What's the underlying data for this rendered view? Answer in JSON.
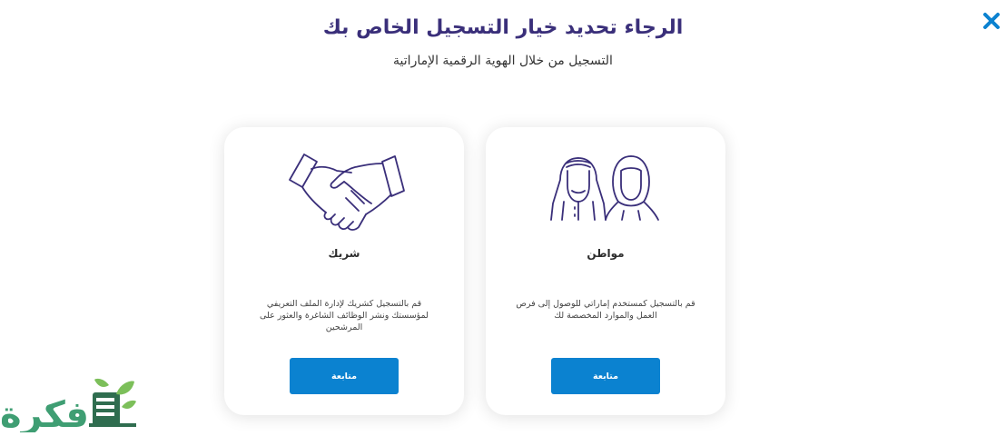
{
  "dialog": {
    "title": "الرجاء تحديد خيار التسجيل الخاص بك",
    "subtitle": "التسجيل من خلال الهوية الرقمية الإماراتية",
    "close_icon": "close-icon",
    "accent_color": "#0b82d0",
    "title_color": "#3a2f7a"
  },
  "cards": {
    "citizen": {
      "title": "مواطن",
      "description": "قم بالتسجيل كمستخدم إماراتي للوصول إلى فرص العمل والموارد المخصصة لك",
      "button_label": "متابعة",
      "icon": "citizens-icon"
    },
    "partner": {
      "title": "شريك",
      "description": "قم بالتسجيل كشريك لإدارة الملف التعريفي لمؤسستك ونشر الوظائف الشاغرة والعثور على المرشحين",
      "button_label": "متابعة",
      "icon": "handshake-icon"
    }
  },
  "watermark": {
    "text": "فكرة"
  }
}
